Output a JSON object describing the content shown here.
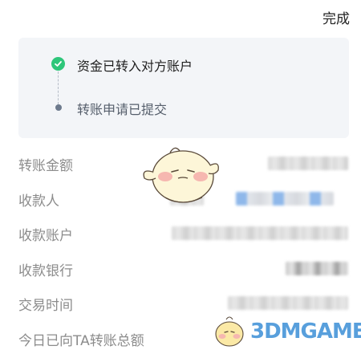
{
  "header": {
    "done_label": "完成"
  },
  "status": {
    "steps": [
      {
        "label": "资金已转入对方账户",
        "state": "completed"
      },
      {
        "label": "转账申请已提交",
        "state": "done"
      }
    ],
    "colors": {
      "success": "#2ec67a",
      "pending_dot": "#6d7a8d"
    }
  },
  "details": {
    "rows": [
      {
        "label": "转账金额",
        "value_hidden": true
      },
      {
        "label": "收款人",
        "value_hidden": true
      },
      {
        "label": "收款账户",
        "value_hidden": true
      },
      {
        "label": "收款银行",
        "value_hidden": true
      },
      {
        "label": "交易时间",
        "value_hidden": true
      },
      {
        "label": "今日已向TA转账总额",
        "value_hidden": true
      }
    ]
  },
  "watermark": {
    "text": "3DMGAME"
  }
}
